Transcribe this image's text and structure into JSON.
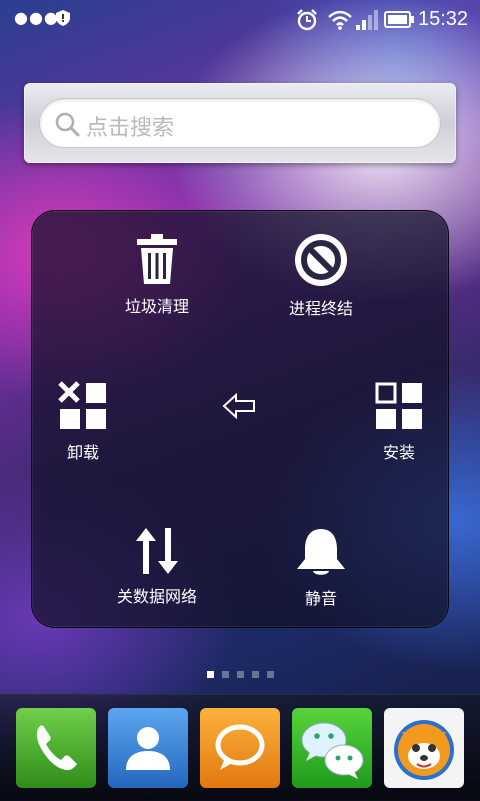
{
  "status_bar": {
    "time": "15:32",
    "icons": [
      "overflow-dots-icon",
      "shield-icon",
      "alarm-icon",
      "wifi-icon",
      "signal-icon",
      "battery-icon"
    ]
  },
  "search": {
    "placeholder": "点击搜索",
    "icon": "search-icon"
  },
  "quick_panel": {
    "items": [
      {
        "label": "垃圾清理",
        "icon": "trash-icon"
      },
      {
        "label": "进程终结",
        "icon": "stop-process-icon"
      },
      {
        "label": "卸载",
        "icon": "uninstall-icon"
      },
      {
        "label": "安装",
        "icon": "install-icon"
      },
      {
        "label": "关数据网络",
        "icon": "data-toggle-icon"
      },
      {
        "label": "静音",
        "icon": "bell-icon"
      }
    ],
    "back_icon": "back-arrow-icon"
  },
  "pager": {
    "pages": 5,
    "current": 1
  },
  "dock": {
    "apps": [
      {
        "name": "phone",
        "icon": "phone-icon",
        "color": "#4caf2a"
      },
      {
        "name": "contacts",
        "icon": "contacts-icon",
        "color": "#3b86d8"
      },
      {
        "name": "messaging",
        "icon": "message-icon",
        "color": "#f39a1e"
      },
      {
        "name": "wechat",
        "icon": "wechat-icon",
        "color": "#2fb62a"
      },
      {
        "name": "uc-browser",
        "icon": "uc-browser-icon",
        "color": "#ffffff"
      }
    ]
  }
}
